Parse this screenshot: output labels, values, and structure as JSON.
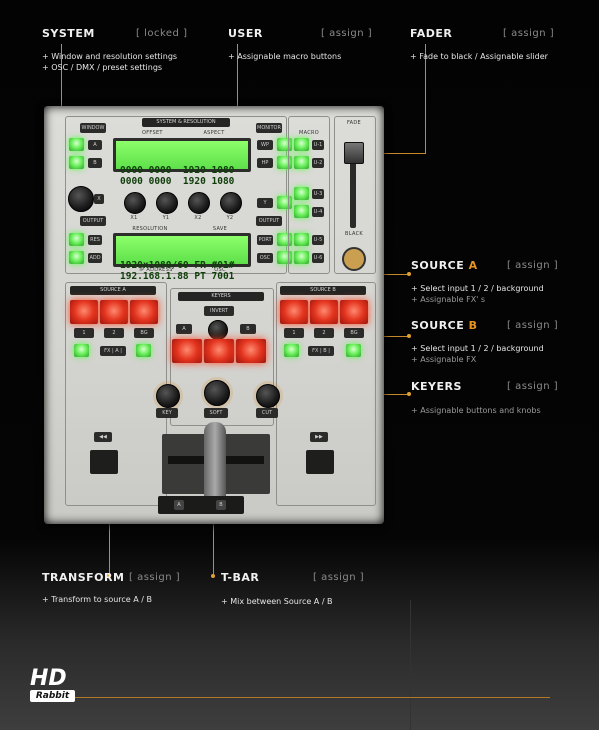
{
  "sections": {
    "system": {
      "title": "SYSTEM",
      "tag": "[ locked ]",
      "lines": [
        "+ Window and resolution settings",
        "+ OSC / DMX / preset settings"
      ]
    },
    "user": {
      "title": "USER",
      "tag": "[ assign ]",
      "lines": [
        "+ Assignable macro buttons"
      ]
    },
    "fader": {
      "title": "FADER",
      "tag": "[ assign ]",
      "lines": [
        "+ Fade to black / Assignable slider"
      ]
    },
    "source_a": {
      "title": "SOURCE",
      "accent": "A",
      "tag": "[ assign ]",
      "line1": "+ Select input 1 / 2 / background",
      "line2": "+ Assignable FX' s"
    },
    "source_b": {
      "title": "SOURCE",
      "accent": "B",
      "tag": "[ assign ]",
      "line1": "+ Select input 1 / 2 / background",
      "line2": "+ Assignable FX"
    },
    "keyers": {
      "title": "KEYERS",
      "tag": "[ assign ]",
      "lines": [
        "+ Assignable buttons and  knobs"
      ]
    },
    "transform": {
      "title": "TRANSFORM",
      "tag": "[ assign ]",
      "lines": [
        "+ Transform to source A / B"
      ]
    },
    "tbar": {
      "title": "T-BAR",
      "tag": "[ assign ]",
      "lines": [
        "+ Mix between Source A / B"
      ]
    }
  },
  "device": {
    "header_label": "SYSTEM & RESOLUTION",
    "window_label": "WINDOW",
    "monitor_label": "MONITOR",
    "offset_label": "OFFSET",
    "aspect_label": "ASPECT",
    "lcd_top": [
      "0000 0000  1920 1080",
      "0000 0000  1920 1080"
    ],
    "lcd_bottom": [
      "1920x1080/60 FR #01#",
      "192.168.1.88 PT 7001"
    ],
    "resolution_label": "RESOLUTION",
    "save_label": "SAVE",
    "ip_address_label": "IP ADDRESS",
    "osc_label": "OSC",
    "macro_label": "MACRO",
    "fade_label": "FADE",
    "black_label": "BLACK",
    "output_label": "OUTPUT",
    "btn_labels": {
      "a": "A",
      "b": "B",
      "x": "X",
      "y": "Y",
      "wp": "WP",
      "hp": "HP",
      "res": "RES",
      "add": "ADD",
      "port": "PORT",
      "osc": "OSC"
    },
    "macro_btns": [
      "U-1",
      "U-2",
      "U-3",
      "U-4",
      "U-5",
      "U-6"
    ],
    "knob_labels": [
      "X1",
      "Y1",
      "X2",
      "Y2"
    ],
    "source_a_label": "SOURCE A",
    "source_b_label": "SOURCE B",
    "keyers_label": "KEYERS",
    "invert_label": "INVERT",
    "input_labels": [
      "1",
      "2",
      "BG"
    ],
    "fx_label": "FX | A |",
    "fxb_label": "FX | B |",
    "knob_bottom_labels": [
      "KEY",
      "SOFT",
      "CUT"
    ],
    "bottom_a": "A",
    "bottom_b": "B"
  },
  "logo": {
    "hd": "HD",
    "rabbit": "Rabbit"
  },
  "colors": {
    "accent": "#e8941f",
    "lead_line": "#c8892a",
    "green": "#6df05e",
    "red": "#e3341f"
  }
}
